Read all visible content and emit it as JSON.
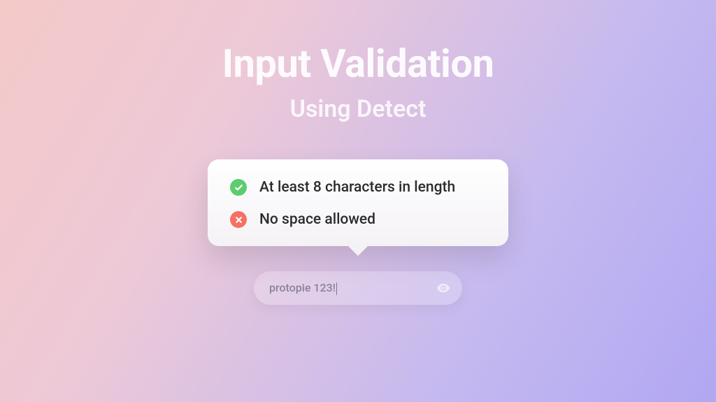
{
  "heading": {
    "title": "Input Validation",
    "subtitle": "Using Detect"
  },
  "rules": [
    {
      "status": "success",
      "text": "At least 8 characters in length"
    },
    {
      "status": "error",
      "text": "No space allowed"
    }
  ],
  "input": {
    "value": "protopie 123!"
  }
}
